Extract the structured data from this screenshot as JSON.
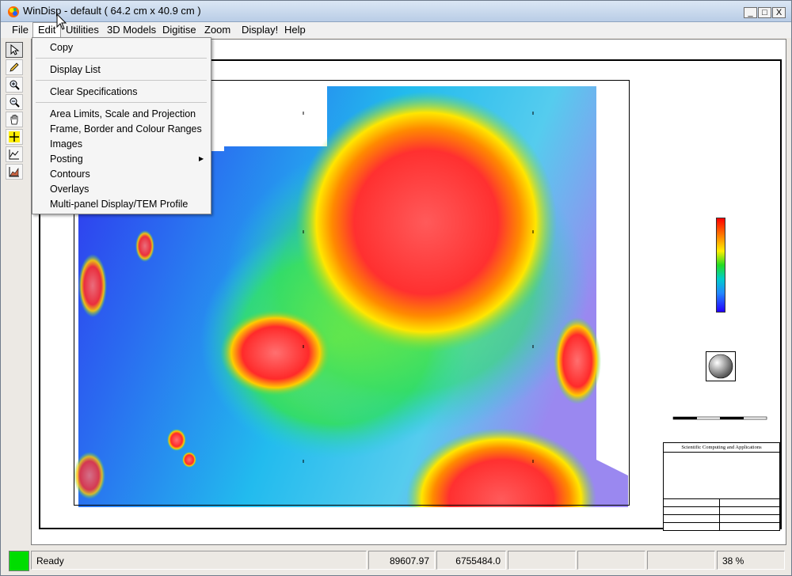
{
  "window": {
    "title": "WinDisp - default ( 64.2 cm x 40.9 cm )",
    "min_glyph": "_",
    "max_glyph": "□",
    "close_glyph": "X"
  },
  "menu": {
    "items": [
      {
        "label": "File"
      },
      {
        "label": "Edit"
      },
      {
        "label": "Utilities"
      },
      {
        "label": "3D Models"
      },
      {
        "label": "Digitise"
      },
      {
        "label": "Zoom"
      },
      {
        "label": "Display!"
      },
      {
        "label": "Help"
      }
    ]
  },
  "edit_menu": {
    "items": [
      {
        "label": "Copy"
      },
      {
        "label": "Display List"
      },
      {
        "label": "Clear Specifications"
      },
      {
        "label": "Area Limits, Scale and Projection"
      },
      {
        "label": "Frame, Border and Colour Ranges"
      },
      {
        "label": "Images"
      },
      {
        "label": "Posting",
        "submenu_arrow": "▶"
      },
      {
        "label": "Contours"
      },
      {
        "label": "Overlays"
      },
      {
        "label": "Multi-panel Display/TEM Profile"
      }
    ]
  },
  "toolbar": {
    "tools": [
      "pointer-icon",
      "pencil-icon",
      "zoom-in-icon",
      "zoom-out-icon",
      "pan-hand-icon",
      "crosshair-icon",
      "profile-line-icon",
      "section-icon"
    ]
  },
  "title_block": {
    "company": "Scientific Computing and Applications"
  },
  "status": {
    "message": "Ready",
    "x_coord": "89607.97",
    "y_coord": "6755484.0",
    "zoom": "38 %"
  },
  "colors": {
    "led": "#00dd00",
    "titlebar_top": "#dbe6f4",
    "titlebar_bottom": "#b9cde6"
  }
}
